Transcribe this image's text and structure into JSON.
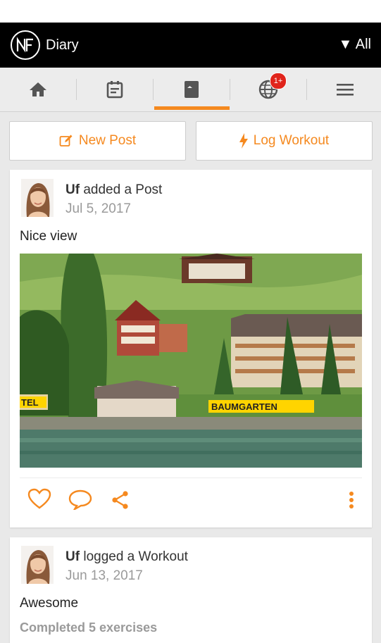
{
  "app": {
    "title": "Diary",
    "filter_label": "▼ All"
  },
  "tabs": [
    {
      "name": "home",
      "icon": "home-icon"
    },
    {
      "name": "calendar",
      "icon": "calendar-icon"
    },
    {
      "name": "diary",
      "icon": "book-icon",
      "active": true
    },
    {
      "name": "community",
      "icon": "globe-icon",
      "badge": "1+"
    },
    {
      "name": "menu",
      "icon": "menu-icon"
    }
  ],
  "actions": {
    "new_post": "New Post",
    "log_workout": "Log Workout"
  },
  "posts": [
    {
      "author": "Uf",
      "action": "added a Post",
      "date": "Jul 5, 2017",
      "text": "Nice view"
    },
    {
      "author": "Uf",
      "action": "logged a Workout",
      "date": "Jun 13, 2017",
      "text": "Awesome",
      "detail": "Completed 5 exercises"
    }
  ],
  "photo_signs": {
    "left": "TEL",
    "right": "BAUMGARTEN"
  },
  "colors": {
    "accent": "#f5891f",
    "appbar": "#000000",
    "badge": "#e0241b"
  }
}
